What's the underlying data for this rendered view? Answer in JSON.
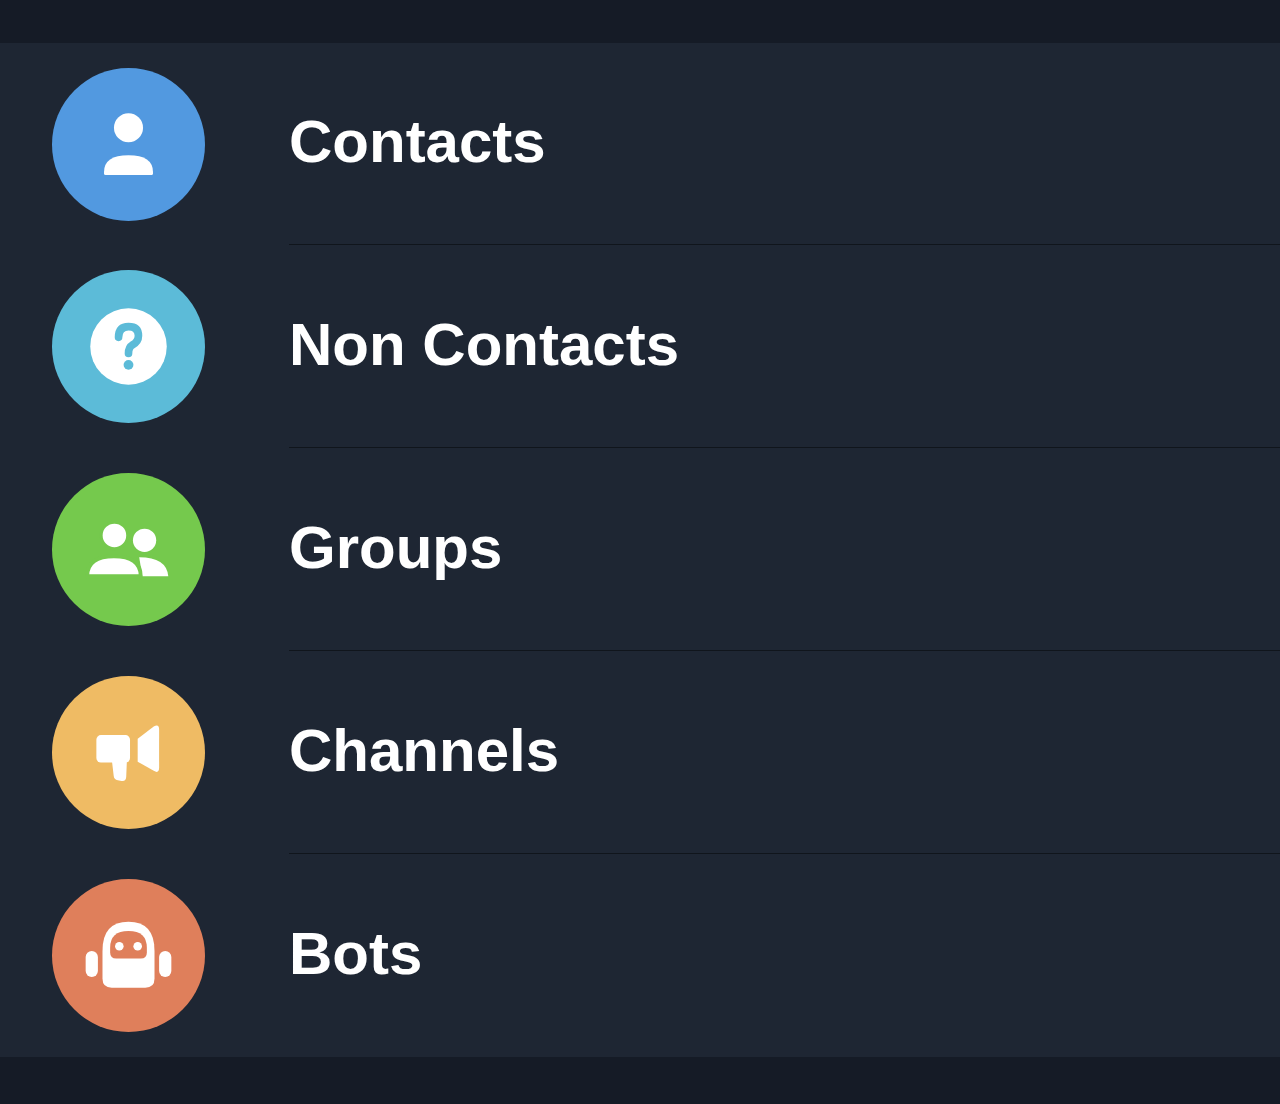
{
  "chat_types": [
    {
      "label": "Contacts",
      "kind": "contacts",
      "color": "#5299e0"
    },
    {
      "label": "Non Contacts",
      "kind": "non_contacts",
      "color": "#5cbbd8"
    },
    {
      "label": "Groups",
      "kind": "groups",
      "color": "#75c94d"
    },
    {
      "label": "Channels",
      "kind": "channels",
      "color": "#efbb64"
    },
    {
      "label": "Bots",
      "kind": "bots",
      "color": "#df7f5b"
    }
  ]
}
